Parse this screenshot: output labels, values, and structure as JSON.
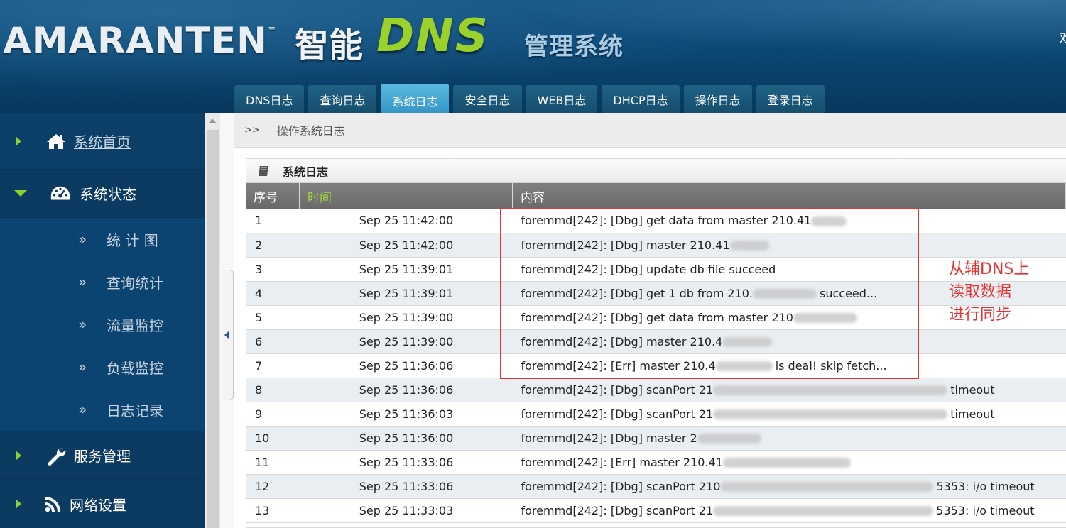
{
  "header": {
    "brand": "AMARANTEN",
    "brand_tm": "™",
    "title_cn": "智能",
    "title_dns": "DNS",
    "title_sys": "管理系统",
    "corner_char": "欢"
  },
  "tabs": [
    {
      "label": "DNS日志",
      "active": false
    },
    {
      "label": "查询日志",
      "active": false
    },
    {
      "label": "系统日志",
      "active": true
    },
    {
      "label": "安全日志",
      "active": false
    },
    {
      "label": "WEB日志",
      "active": false
    },
    {
      "label": "DHCP日志",
      "active": false
    },
    {
      "label": "操作日志",
      "active": false
    },
    {
      "label": "登录日志",
      "active": false
    }
  ],
  "sidebar": {
    "home": {
      "label": "系统首页",
      "icon": "home-icon"
    },
    "status": {
      "label": "系统状态",
      "icon": "dashboard-icon"
    },
    "sub_items": [
      {
        "label": "统 计 图"
      },
      {
        "label": "查询统计"
      },
      {
        "label": "流量监控"
      },
      {
        "label": "负载监控"
      },
      {
        "label": "日志记录"
      }
    ],
    "sub_chevron": "»",
    "service": {
      "label": "服务管理",
      "icon": "wrench-icon"
    },
    "network": {
      "label": "网络设置",
      "icon": "rss-icon"
    }
  },
  "breadcrumb": {
    "sep": ">>",
    "current": "操作系统日志"
  },
  "panel": {
    "title": "系统日志"
  },
  "table": {
    "headers": {
      "no": "序号",
      "time": "时间",
      "content": "内容"
    },
    "rows": [
      {
        "no": "1",
        "time": "Sep 25 11:42:00",
        "msg": "foremmd[242]: [Dbg] get data from master 210.41",
        "tail": ""
      },
      {
        "no": "2",
        "time": "Sep 25 11:42:00",
        "msg": "foremmd[242]: [Dbg] master 210.41",
        "tail": ""
      },
      {
        "no": "3",
        "time": "Sep 25 11:39:01",
        "msg": "foremmd[242]: [Dbg] update db file succeed",
        "tail": ""
      },
      {
        "no": "4",
        "time": "Sep 25 11:39:01",
        "msg": "foremmd[242]: [Dbg] get 1 db from 210.",
        "tail": "succeed..."
      },
      {
        "no": "5",
        "time": "Sep 25 11:39:00",
        "msg": "foremmd[242]: [Dbg] get data from master 210",
        "tail": ""
      },
      {
        "no": "6",
        "time": "Sep 25 11:39:00",
        "msg": "foremmd[242]: [Dbg] master 210.4",
        "tail": ""
      },
      {
        "no": "7",
        "time": "Sep 25 11:36:06",
        "msg": "foremmd[242]: [Err] master 210.4",
        "tail": "is deal! skip fetch..."
      },
      {
        "no": "8",
        "time": "Sep 25 11:36:06",
        "msg": "foremmd[242]: [Dbg] scanPort 21",
        "tail": "timeout"
      },
      {
        "no": "9",
        "time": "Sep 25 11:36:03",
        "msg": "foremmd[242]: [Dbg] scanPort 21",
        "tail": "timeout"
      },
      {
        "no": "10",
        "time": "Sep 25 11:36:00",
        "msg": "foremmd[242]: [Dbg] master 2",
        "tail": ""
      },
      {
        "no": "11",
        "time": "Sep 25 11:33:06",
        "msg": "foremmd[242]: [Err] master 210.41",
        "tail": ""
      },
      {
        "no": "12",
        "time": "Sep 25 11:33:06",
        "msg": "foremmd[242]: [Dbg] scanPort 210",
        "tail": "5353: i/o timeout"
      },
      {
        "no": "13",
        "time": "Sep 25 11:33:03",
        "msg": "foremmd[242]: [Dbg] scanPort 21",
        "tail": "5353: i/o timeout"
      }
    ]
  },
  "annotation": {
    "lines": [
      "从辅DNS上",
      "读取数据",
      "进行同步"
    ],
    "color": "#e53333"
  },
  "colors": {
    "header_bg": "#0b4672",
    "sidebar_bg": "#0b3f68",
    "accent_green": "#8fd12c",
    "tab_active": "#3596c6"
  }
}
